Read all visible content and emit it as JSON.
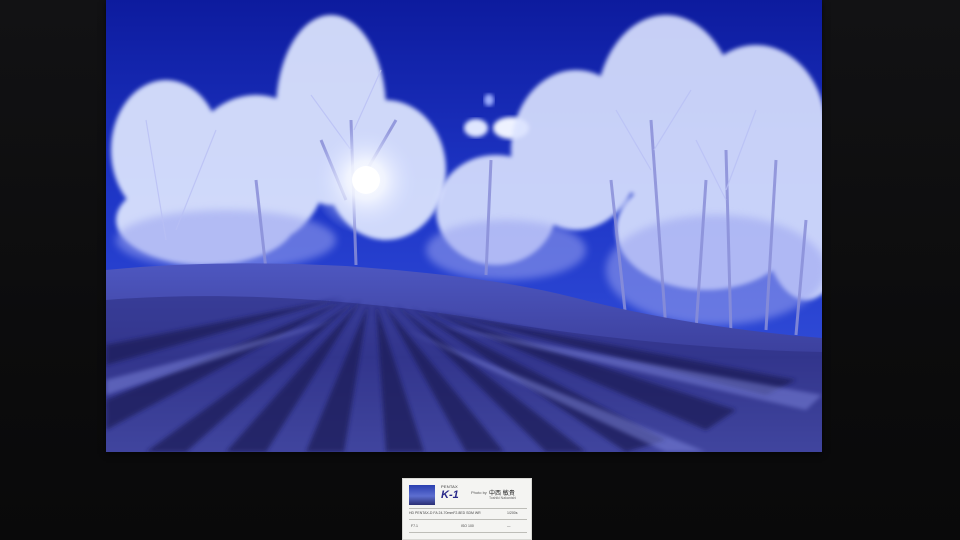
{
  "scene": {
    "subject": "Frost-covered trees in snow under a deep blue sky with sun behind the trees"
  },
  "caption_card": {
    "brand": "PENTAX",
    "model": "K-1",
    "photo_by": "Photo by",
    "author": "中西 敏貴",
    "author_romaji": "Toshiki Nakanishi",
    "lens": "HD PENTAX-D FA 24-70mmF2.8ED SDM WR",
    "shutter": "1/200s",
    "aperture": "F7.1",
    "iso": "ISO 100",
    "extra": "—"
  },
  "colors": {
    "sky_top": "#0d1fa8",
    "sky_mid": "#2a45d8",
    "snow": "#5a63c8",
    "shadow": "#1a1c5a",
    "frost": "#e8efff"
  }
}
